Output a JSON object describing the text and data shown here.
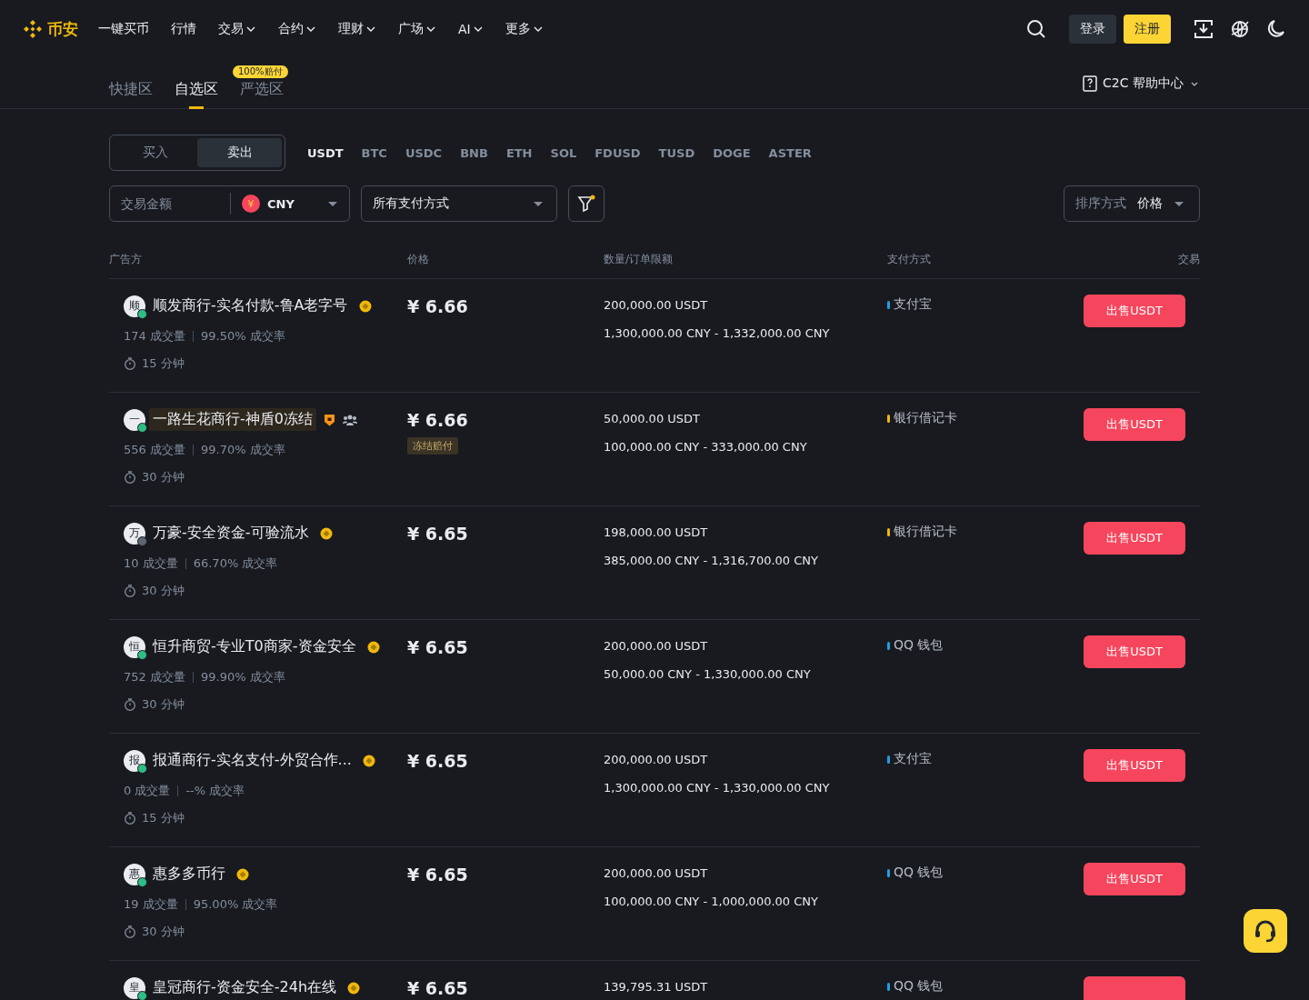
{
  "header": {
    "logo": "币安",
    "nav": [
      {
        "label": "一键买币",
        "dropdown": false
      },
      {
        "label": "行情",
        "dropdown": false
      },
      {
        "label": "交易",
        "dropdown": true
      },
      {
        "label": "合约",
        "dropdown": true
      },
      {
        "label": "理财",
        "dropdown": true
      },
      {
        "label": "广场",
        "dropdown": true
      },
      {
        "label": "AI",
        "dropdown": true
      },
      {
        "label": "更多",
        "dropdown": true
      }
    ],
    "login": "登录",
    "register": "注册"
  },
  "zones": [
    {
      "label": "快捷区",
      "selected": false
    },
    {
      "label": "自选区",
      "selected": true
    },
    {
      "label": "严选区",
      "selected": false,
      "badge": "100%赔付"
    }
  ],
  "help": "C2C 帮助中心",
  "side_toggle": [
    {
      "label": "买入",
      "selected": false
    },
    {
      "label": "卖出",
      "selected": true
    }
  ],
  "assets": [
    {
      "label": "USDT",
      "selected": true
    },
    {
      "label": "BTC",
      "selected": false
    },
    {
      "label": "USDC",
      "selected": false
    },
    {
      "label": "BNB",
      "selected": false
    },
    {
      "label": "ETH",
      "selected": false
    },
    {
      "label": "SOL",
      "selected": false
    },
    {
      "label": "FDUSD",
      "selected": false
    },
    {
      "label": "TUSD",
      "selected": false
    },
    {
      "label": "DOGE",
      "selected": false
    },
    {
      "label": "ASTER",
      "selected": false
    }
  ],
  "filters": {
    "amount_placeholder": "交易金额",
    "currency": "CNY",
    "currency_symbol": "¥",
    "payment": "所有支付方式",
    "sort_label": "排序方式",
    "sort_value": "价格"
  },
  "table": {
    "columns": [
      "广告方",
      "价格",
      "数量/订单限额",
      "支付方式",
      "交易"
    ],
    "rows": [
      {
        "avatar": "顺",
        "online": true,
        "name": "顺发商行-实名付款-鲁A老字号",
        "highlighted": false,
        "verified": true,
        "shield": false,
        "group": false,
        "trades": "174 成交量",
        "rate": "99.50% 成交率",
        "time": "15 分钟",
        "price": "¥ 6.66",
        "tag": null,
        "quantity": "200,000.00 USDT",
        "limit": "1,300,000.00 CNY - 1,332,000.00 CNY",
        "payment": {
          "name": "支付宝",
          "color": "#1e9fe8"
        },
        "action": "出售USDT"
      },
      {
        "avatar": "一",
        "online": true,
        "name": "一路生花商行-神盾0冻结",
        "highlighted": true,
        "verified": false,
        "shield": true,
        "group": true,
        "trades": "556 成交量",
        "rate": "99.70% 成交率",
        "time": "30 分钟",
        "price": "¥ 6.66",
        "tag": "冻结赔付",
        "quantity": "50,000.00 USDT",
        "limit": "100,000.00 CNY - 333,000.00 CNY",
        "payment": {
          "name": "银行借记卡",
          "color": "#f0b90b"
        },
        "action": "出售USDT"
      },
      {
        "avatar": "万",
        "online": false,
        "name": "万豪-安全资金-可验流水",
        "highlighted": false,
        "verified": true,
        "shield": false,
        "group": false,
        "trades": "10 成交量",
        "rate": "66.70% 成交率",
        "time": "30 分钟",
        "price": "¥ 6.65",
        "tag": null,
        "quantity": "198,000.00 USDT",
        "limit": "385,000.00 CNY - 1,316,700.00 CNY",
        "payment": {
          "name": "银行借记卡",
          "color": "#f0b90b"
        },
        "action": "出售USDT"
      },
      {
        "avatar": "恒",
        "online": true,
        "name": "恒升商贸-专业T0商家-资金安全",
        "highlighted": false,
        "verified": true,
        "shield": false,
        "group": false,
        "trades": "752 成交量",
        "rate": "99.90% 成交率",
        "time": "30 分钟",
        "price": "¥ 6.65",
        "tag": null,
        "quantity": "200,000.00 USDT",
        "limit": "50,000.00 CNY - 1,330,000.00 CNY",
        "payment": {
          "name": "QQ 钱包",
          "color": "#1e9fe8"
        },
        "action": "出售USDT"
      },
      {
        "avatar": "报",
        "online": true,
        "name": "报通商行-实名支付-外贸合作...",
        "highlighted": false,
        "verified": true,
        "shield": false,
        "group": false,
        "trades": "0 成交量",
        "rate": "--% 成交率",
        "time": "15 分钟",
        "price": "¥ 6.65",
        "tag": null,
        "quantity": "200,000.00 USDT",
        "limit": "1,300,000.00 CNY - 1,330,000.00 CNY",
        "payment": {
          "name": "支付宝",
          "color": "#1e9fe8"
        },
        "action": "出售USDT"
      },
      {
        "avatar": "惠",
        "online": true,
        "name": "惠多多币行",
        "highlighted": false,
        "verified": true,
        "shield": false,
        "group": false,
        "trades": "19 成交量",
        "rate": "95.00% 成交率",
        "time": "30 分钟",
        "price": "¥ 6.65",
        "tag": null,
        "quantity": "200,000.00 USDT",
        "limit": "100,000.00 CNY - 1,000,000.00 CNY",
        "payment": {
          "name": "QQ 钱包",
          "color": "#1e9fe8"
        },
        "action": "出售USDT"
      },
      {
        "avatar": "皇",
        "online": true,
        "name": "皇冠商行-资金安全-24h在线",
        "highlighted": false,
        "verified": true,
        "shield": false,
        "group": false,
        "price": "¥ 6.65",
        "tag": null,
        "quantity": "139,795.31 USDT",
        "payment": {
          "name": "QQ 钱包",
          "color": "#1e9fe8"
        }
      }
    ]
  }
}
